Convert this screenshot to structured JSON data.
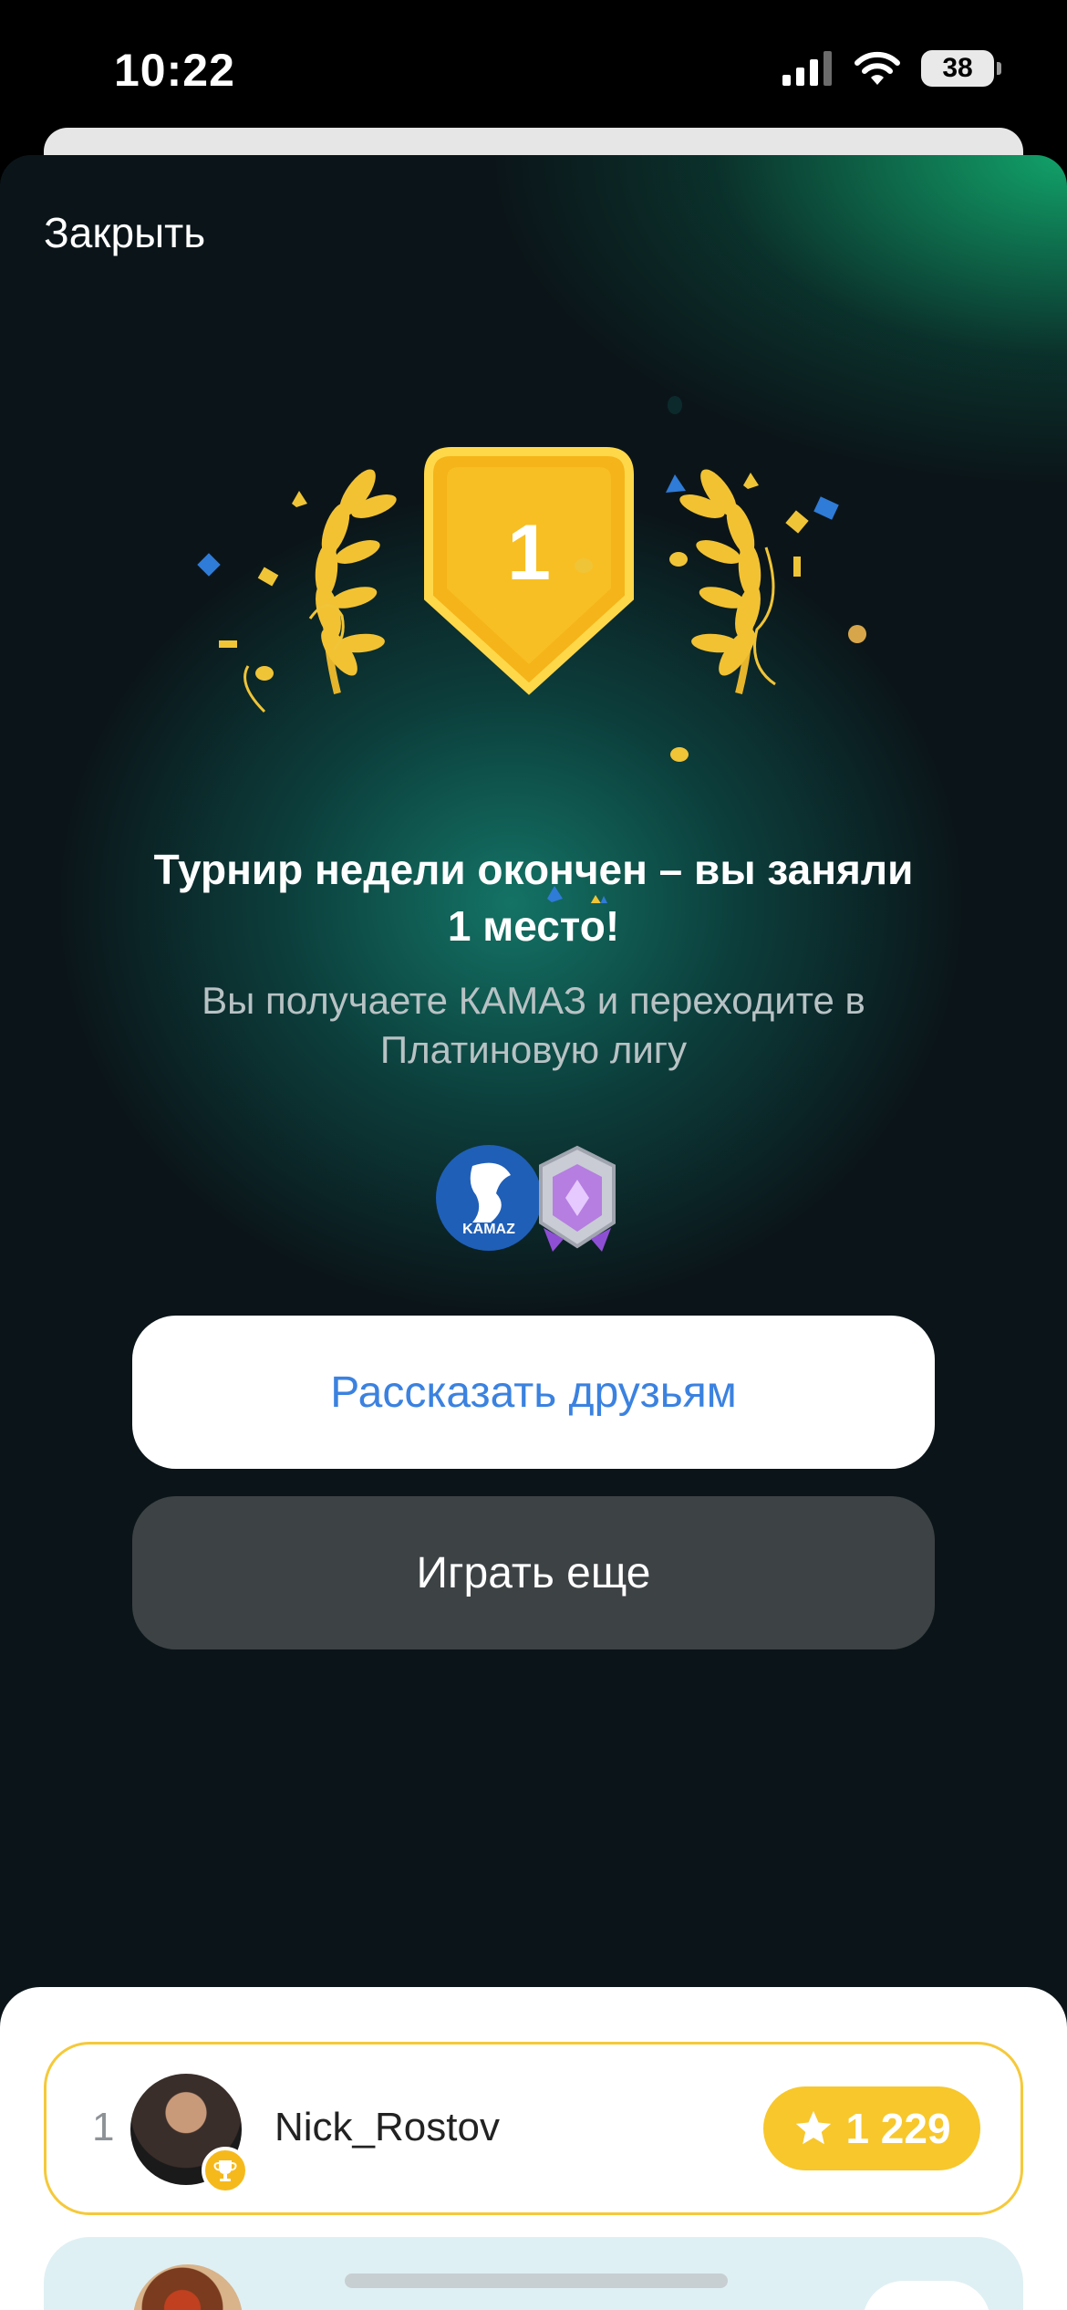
{
  "status_bar": {
    "time": "10:22",
    "battery": "38"
  },
  "modal": {
    "close_label": "Закрыть",
    "place_number": "1",
    "title": "Турнир недели окончен – вы заняли 1 место!",
    "subtitle": "Вы получаете КАМАЗ и переходите в Платиновую лигу",
    "reward_brand_label": "KAMAZ",
    "share_button": "Рассказать друзьям",
    "play_button": "Играть еще"
  },
  "leaderboard": {
    "rows": [
      {
        "rank": "1",
        "username": "Nick_Rostov",
        "score": "1 229"
      }
    ]
  },
  "colors": {
    "accent_blue": "#3b82e0",
    "gold": "#f7c72c",
    "dark_button": "#3d4245"
  }
}
